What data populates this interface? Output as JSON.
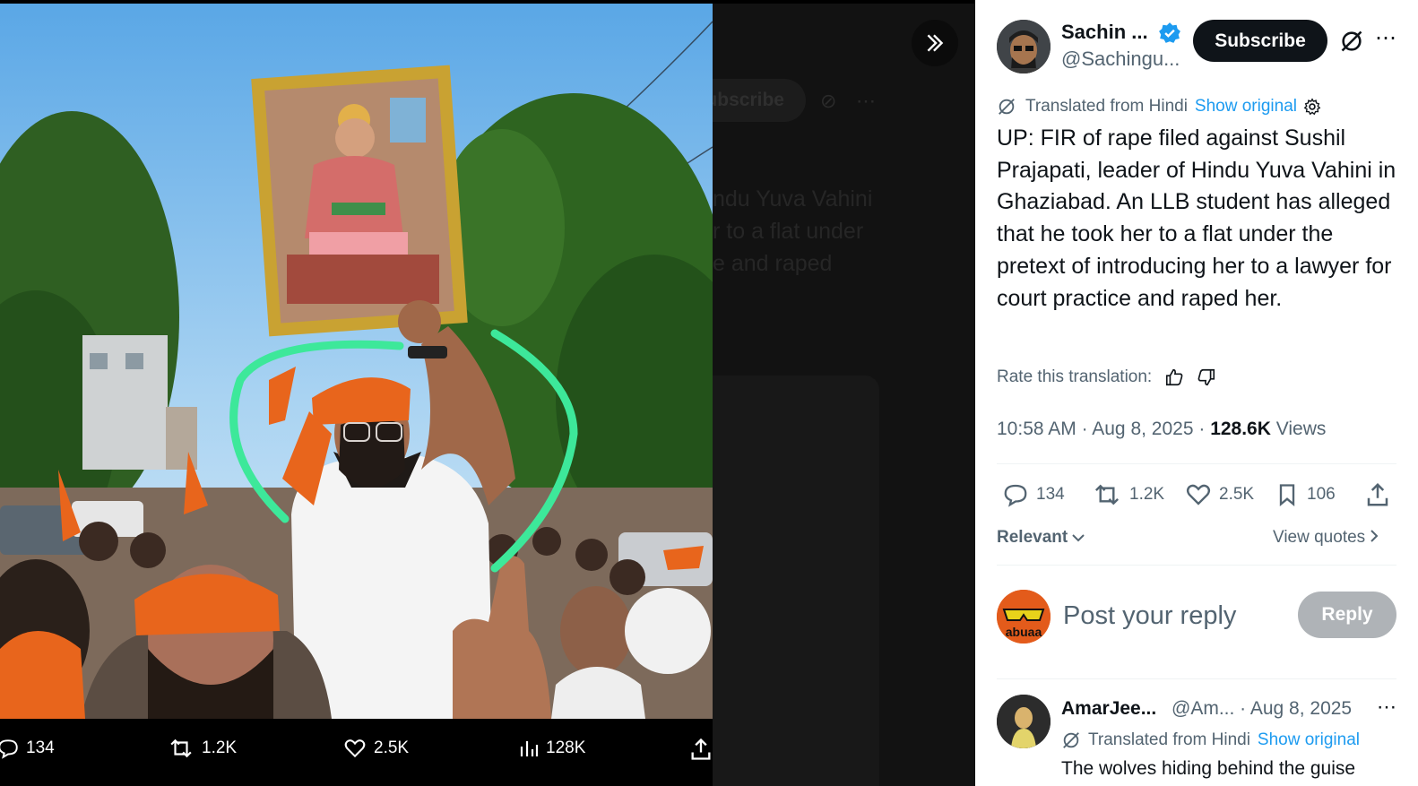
{
  "media_actions": {
    "replies": "134",
    "reposts": "1.2K",
    "likes": "2.5K",
    "views": "128K"
  },
  "background_ghost": {
    "subscribe": "Subscribe",
    "text_lines": [
      "ndu Yuva Vahini",
      "r to a flat under",
      "e and raped"
    ]
  },
  "post": {
    "author": {
      "name": "Sachin ...",
      "handle": "@Sachingu...",
      "verified": true
    },
    "subscribe_label": "Subscribe",
    "translated_label": "Translated from Hindi",
    "show_original_label": "Show original",
    "text": "UP: FIR of rape filed against Sushil Prajapati, leader of Hindu Yuva Vahini in Ghaziabad. An LLB student has alleged that he took her to a flat under the pretext of introducing her to a lawyer for court practice and raped her.",
    "rate_label": "Rate this translation:",
    "time": "10:58 AM",
    "date": "Aug 8, 2025",
    "views_count": "128.6K",
    "views_label": "Views",
    "stats": {
      "replies": "134",
      "reposts": "1.2K",
      "likes": "2.5K",
      "bookmarks": "106"
    },
    "sort_label": "Relevant",
    "view_quotes_label": "View quotes"
  },
  "reply_box": {
    "placeholder": "Post your reply",
    "button_label": "Reply",
    "avatar_text": "abuaa"
  },
  "comment": {
    "name": "AmarJee...",
    "handle": "@Am...",
    "date": "Aug 8, 2025",
    "translated_label": "Translated from Hindi",
    "show_original_label": "Show original",
    "text": "The wolves hiding behind the guise"
  },
  "colors": {
    "accent": "#1d9bf0",
    "primary_text": "#0f1419",
    "secondary_text": "#536471",
    "saffron": "#e8651c",
    "highlight_circle": "#3de89a"
  }
}
